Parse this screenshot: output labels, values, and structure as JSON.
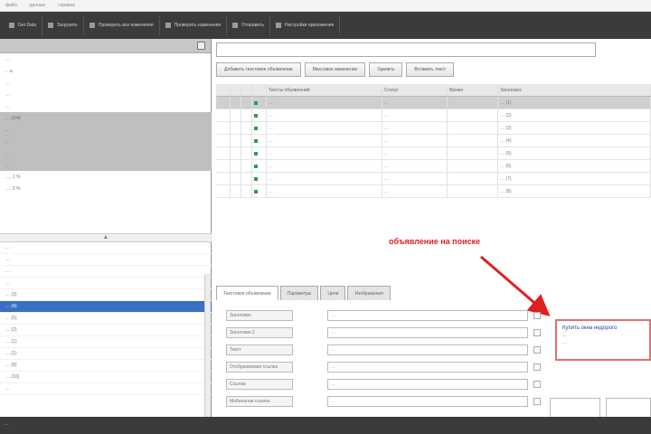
{
  "menu": {
    "items": [
      "файл",
      "данные",
      "справка"
    ]
  },
  "toolbar": {
    "buttons": [
      {
        "label": "Get Data"
      },
      {
        "label": "Загрузить"
      },
      {
        "label": "Проверить все изменения"
      },
      {
        "label": "Проверить изменения"
      },
      {
        "label": "Отправить"
      },
      {
        "label": "Настройки приложения"
      }
    ]
  },
  "left_panel": {
    "tree": [
      {
        "label": "…"
      },
      {
        "label": "…a"
      },
      {
        "label": "…"
      },
      {
        "label": "…"
      },
      {
        "label": "…"
      },
      {
        "label": "… (1/4)",
        "gray": true
      },
      {
        "label": "…",
        "gray": true
      },
      {
        "label": "…",
        "gray": true
      },
      {
        "label": "…",
        "gray": true
      },
      {
        "label": "…",
        "gray": true
      },
      {
        "label": "…, 1 %"
      },
      {
        "label": "…, 3 %"
      }
    ],
    "splitter": "▲",
    "campaigns": [
      {
        "label": "…"
      },
      {
        "label": "…"
      },
      {
        "label": "…"
      },
      {
        "label": "…"
      },
      {
        "label": "… (3)"
      },
      {
        "label": "… (4)",
        "selected": true
      },
      {
        "label": "… (5)"
      },
      {
        "label": "… (2)"
      },
      {
        "label": "… (1)"
      },
      {
        "label": "… (1)"
      },
      {
        "label": "… (8)"
      },
      {
        "label": "… (10)"
      },
      {
        "label": "…"
      }
    ]
  },
  "search": {
    "placeholder": ""
  },
  "actions": [
    {
      "label": "Добавить текстовое объявление"
    },
    {
      "label": "Массовое изменение"
    },
    {
      "label": "Удалить"
    },
    {
      "label": "Вставить текст"
    }
  ],
  "grid": {
    "headers": [
      "",
      "",
      "",
      "",
      "Тексты объявлений",
      "Статус",
      "Время",
      "Заголовок"
    ],
    "rows": [
      {
        "name": "…",
        "status": "…",
        "time": "",
        "title": "… (1)"
      },
      {
        "name": "…",
        "status": "…",
        "time": "",
        "title": "… (2)"
      },
      {
        "name": "…",
        "status": "…",
        "time": "",
        "title": "… (3)"
      },
      {
        "name": "…",
        "status": "…",
        "time": "",
        "title": "… (4)"
      },
      {
        "name": "…",
        "status": "…",
        "time": "",
        "title": "… (5)"
      },
      {
        "name": "…",
        "status": "…",
        "time": "",
        "title": "… (6)"
      },
      {
        "name": "…",
        "status": "…",
        "time": "",
        "title": "… (7)"
      },
      {
        "name": "…",
        "status": "…",
        "time": "",
        "title": "… (8)"
      }
    ]
  },
  "annotation": {
    "text": "объявление на поиске"
  },
  "bottom_tabs": [
    {
      "label": "Текстовое объявление",
      "active": true
    },
    {
      "label": "Параметры"
    },
    {
      "label": "Цели"
    },
    {
      "label": "Изображения"
    }
  ],
  "form": [
    {
      "label": "Заголовок",
      "value": "…"
    },
    {
      "label": "Заголовок 2",
      "value": "…"
    },
    {
      "label": "Текст",
      "value": "…"
    },
    {
      "label": "Отображаемая ссылка",
      "value": "…"
    },
    {
      "label": "Ссылка",
      "value": "…"
    },
    {
      "label": "Мобильная ссылка",
      "value": "…"
    }
  ],
  "preview": {
    "title": "Купить окна недорого",
    "url": "…",
    "text": "…"
  },
  "status": {
    "text": "…"
  },
  "colors": {
    "toolbar": "#3b3b3b",
    "selection": "#3a6fc4",
    "annotation": "#e02020",
    "preview_border": "#e07070"
  }
}
